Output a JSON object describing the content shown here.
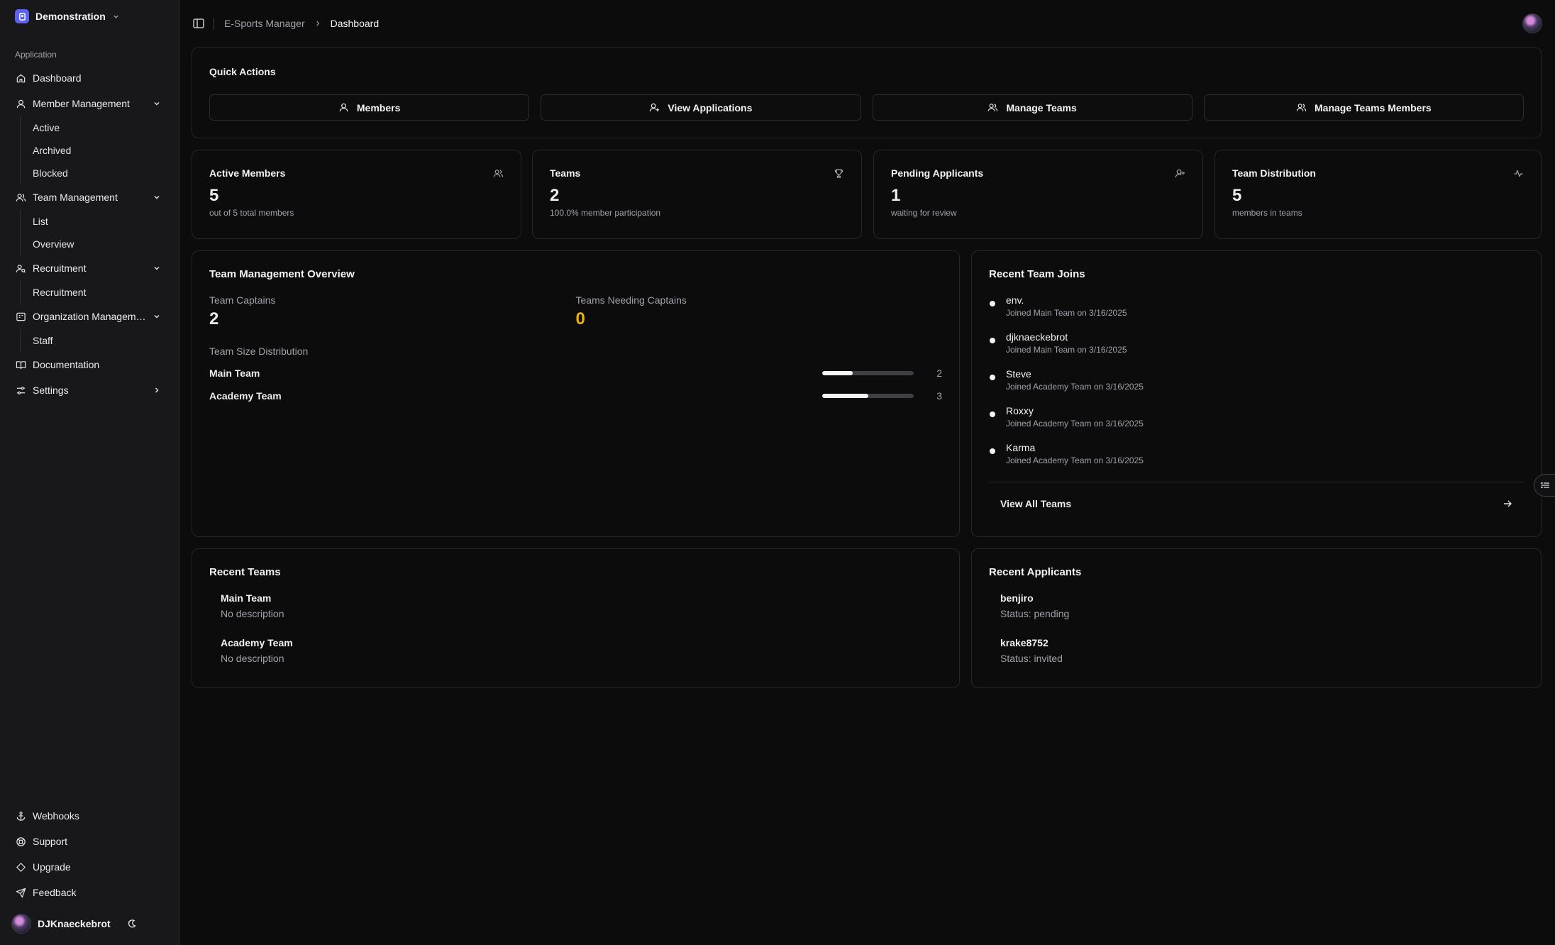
{
  "workspace": {
    "name": "Demonstration"
  },
  "sidebar": {
    "section_label": "Application",
    "dashboard": "Dashboard",
    "member_management": {
      "label": "Member Management",
      "items": [
        "Active",
        "Archived",
        "Blocked"
      ]
    },
    "team_management": {
      "label": "Team Management",
      "items": [
        "List",
        "Overview"
      ]
    },
    "recruitment": {
      "label": "Recruitment",
      "items": [
        "Recruitment"
      ]
    },
    "organization": {
      "label": "Organization Managem…",
      "items": [
        "Staff"
      ]
    },
    "documentation": "Documentation",
    "settings": "Settings",
    "footer": {
      "webhooks": "Webhooks",
      "support": "Support",
      "upgrade": "Upgrade",
      "feedback": "Feedback"
    },
    "user": "DJKnaeckebrot"
  },
  "breadcrumb": {
    "parent": "E-Sports Manager",
    "current": "Dashboard"
  },
  "quick_actions": {
    "title": "Quick Actions",
    "buttons": [
      "Members",
      "View Applications",
      "Manage Teams",
      "Manage Teams Members"
    ]
  },
  "stats": [
    {
      "title": "Active Members",
      "value": "5",
      "sub": "out of 5 total members",
      "icon": "users-icon"
    },
    {
      "title": "Teams",
      "value": "2",
      "sub": "100.0% member participation",
      "icon": "trophy-icon"
    },
    {
      "title": "Pending Applicants",
      "value": "1",
      "sub": "waiting for review",
      "icon": "user-plus-icon"
    },
    {
      "title": "Team Distribution",
      "value": "5",
      "sub": "members in teams",
      "icon": "activity-icon"
    }
  ],
  "team_overview": {
    "title": "Team Management Overview",
    "captains_label": "Team Captains",
    "captains_value": "2",
    "needing_label": "Teams Needing Captains",
    "needing_value": "0",
    "distribution_label": "Team Size Distribution",
    "teams": [
      {
        "name": "Main Team",
        "count": "2",
        "fraction": 0.33
      },
      {
        "name": "Academy Team",
        "count": "3",
        "fraction": 0.5
      }
    ]
  },
  "recent_joins": {
    "title": "Recent Team Joins",
    "items": [
      {
        "name": "env.",
        "detail": "Joined Main Team on 3/16/2025"
      },
      {
        "name": "djknaeckebrot",
        "detail": "Joined Main Team on 3/16/2025"
      },
      {
        "name": "Steve",
        "detail": "Joined Academy Team on 3/16/2025"
      },
      {
        "name": "Roxxy",
        "detail": "Joined Academy Team on 3/16/2025"
      },
      {
        "name": "Karma",
        "detail": "Joined Academy Team on 3/16/2025"
      }
    ],
    "view_all": "View All Teams"
  },
  "recent_teams": {
    "title": "Recent Teams",
    "items": [
      {
        "name": "Main Team",
        "desc": "No description"
      },
      {
        "name": "Academy Team",
        "desc": "No description"
      }
    ]
  },
  "recent_applicants": {
    "title": "Recent Applicants",
    "items": [
      {
        "name": "benjiro",
        "status": "Status: pending"
      },
      {
        "name": "krake8752",
        "status": "Status: invited"
      }
    ]
  },
  "colors": {
    "accent": "#5b63f0",
    "warning": "#eab308",
    "background": "#0c0c0d",
    "sidebar": "#18181b"
  }
}
